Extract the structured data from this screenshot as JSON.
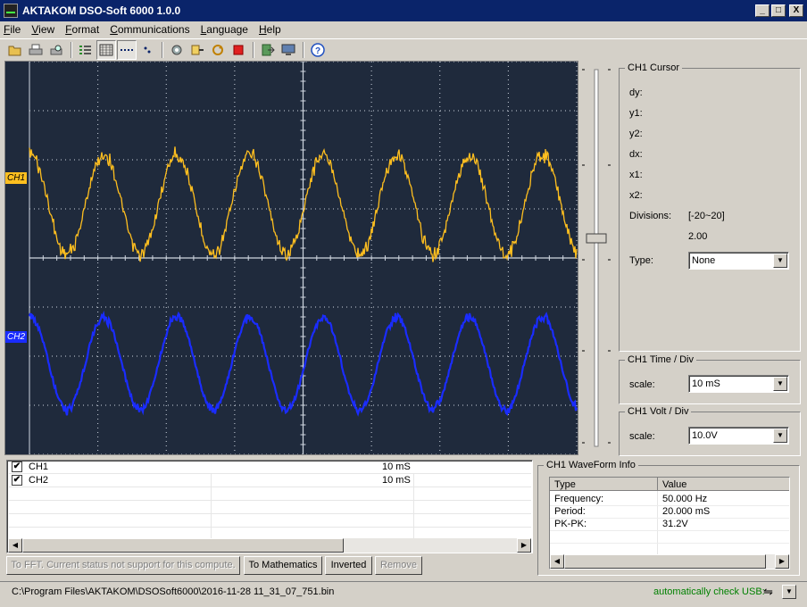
{
  "window": {
    "title": "AKTAKOM DSO-Soft 6000 1.0.0",
    "min": "_",
    "max": "□",
    "close": "X"
  },
  "menu": [
    "File",
    "View",
    "Format",
    "Communications",
    "Language",
    "Help"
  ],
  "toolbar": {
    "help": "?"
  },
  "scope": {
    "ch1_marker": "CH1",
    "ch2_marker": "CH2",
    "ch1_color": "#ffbf1f",
    "ch2_color": "#1a2cff",
    "grid_color": "#cfd6e0"
  },
  "cursor_panel": {
    "title": "CH1 Cursor",
    "dy": "dy:",
    "y1": "y1:",
    "y2": "y2:",
    "dx": "dx:",
    "x1": "x1:",
    "x2": "x2:",
    "divisions_label": "Divisions:",
    "divisions_range": "[-20~20]",
    "divisions_value": "2.00",
    "type_label": "Type:",
    "type_value": "None"
  },
  "time_panel": {
    "title": "CH1 Time / Div",
    "scale_label": "scale:",
    "scale_value": "10 mS"
  },
  "volt_panel": {
    "title": "CH1 Volt / Div",
    "scale_label": "scale:",
    "scale_value": "10.0V"
  },
  "channels": [
    {
      "name": "CH1",
      "time": "10 mS",
      "checked": "✔"
    },
    {
      "name": "CH2",
      "time": "10 mS",
      "checked": "✔"
    }
  ],
  "buttons": {
    "fft": "To FFT. Current status not support for this compute.",
    "math": "To Mathematics",
    "inverted": "Inverted",
    "remove": "Remove"
  },
  "waveform_info": {
    "title": "CH1 WaveForm Info",
    "col_type": "Type",
    "col_value": "Value",
    "rows": [
      {
        "type": "Frequency:",
        "value": "50.000 Hz"
      },
      {
        "type": "Period:",
        "value": "20.000 mS"
      },
      {
        "type": "PK-PK:",
        "value": "31.2V"
      }
    ]
  },
  "status": {
    "path": "C:\\Program Files\\AKTAKOM\\DSOSoft6000\\2016-11-28 11_31_07_751.bin",
    "usb": "automatically check USB:"
  }
}
